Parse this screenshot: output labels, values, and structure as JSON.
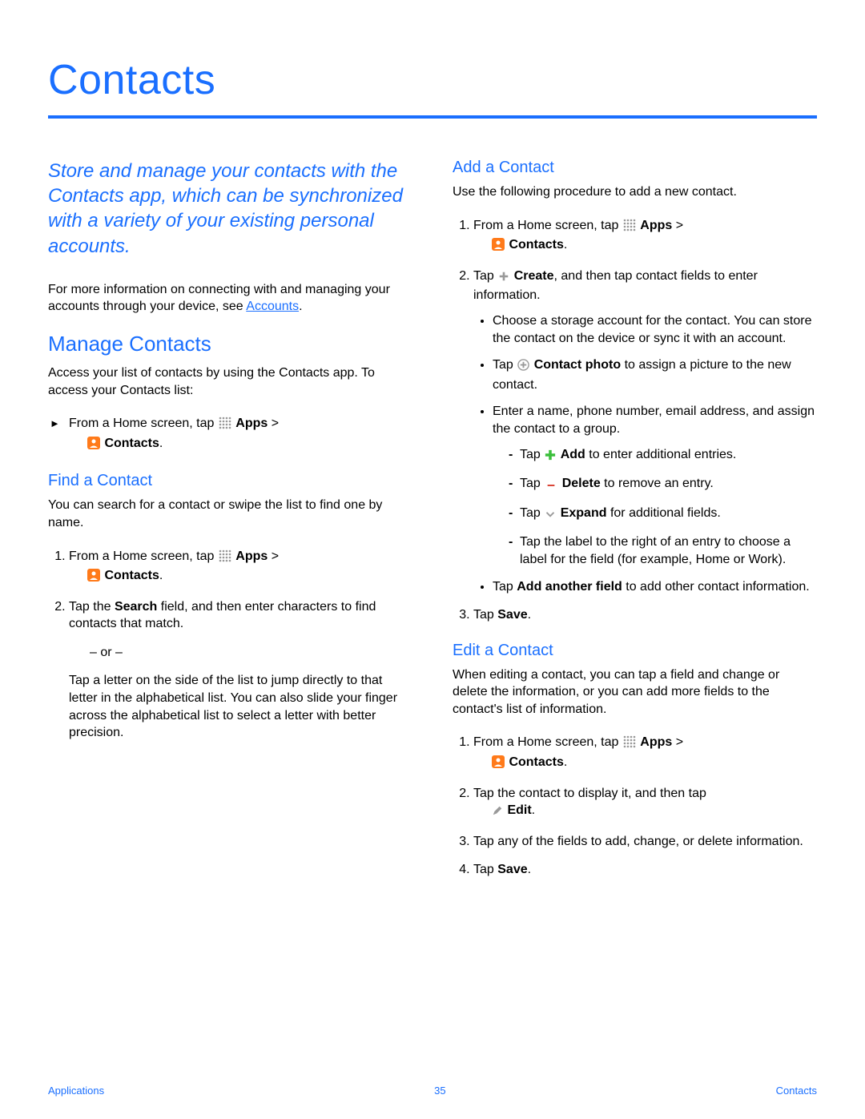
{
  "page": {
    "title": "Contacts",
    "intro": "Store and manage your contacts with the Contacts app, which can be synchronized with a variety of your existing personal accounts.",
    "more_info_prefix": "For more information on connecting with and managing your accounts through your device, see ",
    "more_info_link": "Accounts",
    "more_info_suffix": "."
  },
  "manage": {
    "heading": "Manage Contacts",
    "intro": "Access your list of contacts by using the Contacts app. To access your Contacts list:",
    "step1_prefix": "From a Home screen, tap ",
    "apps_label": "Apps",
    "gt": " > ",
    "contacts_label": "Contacts",
    "period": "."
  },
  "find": {
    "heading": "Find a Contact",
    "intro": "You can search for a contact or swipe the list to find one by name.",
    "step1_prefix": "From a Home screen, tap ",
    "step2_a": "Tap the ",
    "step2_b": "Search",
    "step2_c": " field, and then enter characters to find contacts that match.",
    "or": "– or –",
    "step2_alt": "Tap a letter on the side of the list to jump directly to that letter in the alphabetical list. You can also slide your finger across the alphabetical list to select a letter with better precision."
  },
  "add": {
    "heading": "Add a Contact",
    "intro": "Use the following procedure to add a new contact.",
    "step1_prefix": "From a Home screen, tap ",
    "step2_a": "Tap ",
    "step2_b": "Create",
    "step2_c": ", and then tap contact fields to enter information.",
    "b1": "Choose a storage account for the contact. You can store the contact on the device or sync it with an account.",
    "b2_a": "Tap ",
    "b2_b": "Contact photo",
    "b2_c": " to assign a picture to the new contact.",
    "b3": "Enter a name, phone number, email address, and assign the contact to a group.",
    "d1_a": "Tap ",
    "d1_b": "Add",
    "d1_c": " to enter additional entries.",
    "d2_a": "Tap ",
    "d2_b": "Delete",
    "d2_c": " to remove an entry.",
    "d3_a": "Tap ",
    "d3_b": "Expand",
    "d3_c": " for additional fields.",
    "d4": "Tap the label to the right of an entry to choose a label for the field (for example, Home or Work).",
    "b4_a": "Tap ",
    "b4_b": "Add another field",
    "b4_c": " to add other contact information.",
    "step3_a": "Tap ",
    "step3_b": "Save",
    "step3_c": "."
  },
  "edit": {
    "heading": "Edit a Contact",
    "intro": "When editing a contact, you can tap a field and change or delete the information, or you can add more fields to the contact's list of information.",
    "step1_prefix": "From a Home screen, tap ",
    "step2_a": "Tap the contact to display it, and then tap ",
    "step2_b": "Edit",
    "step2_c": ".",
    "step3": "Tap any of the fields to add, change, or delete information.",
    "step4_a": "Tap ",
    "step4_b": "Save",
    "step4_c": "."
  },
  "footer": {
    "left": "Applications",
    "center": "35",
    "right": "Contacts"
  }
}
